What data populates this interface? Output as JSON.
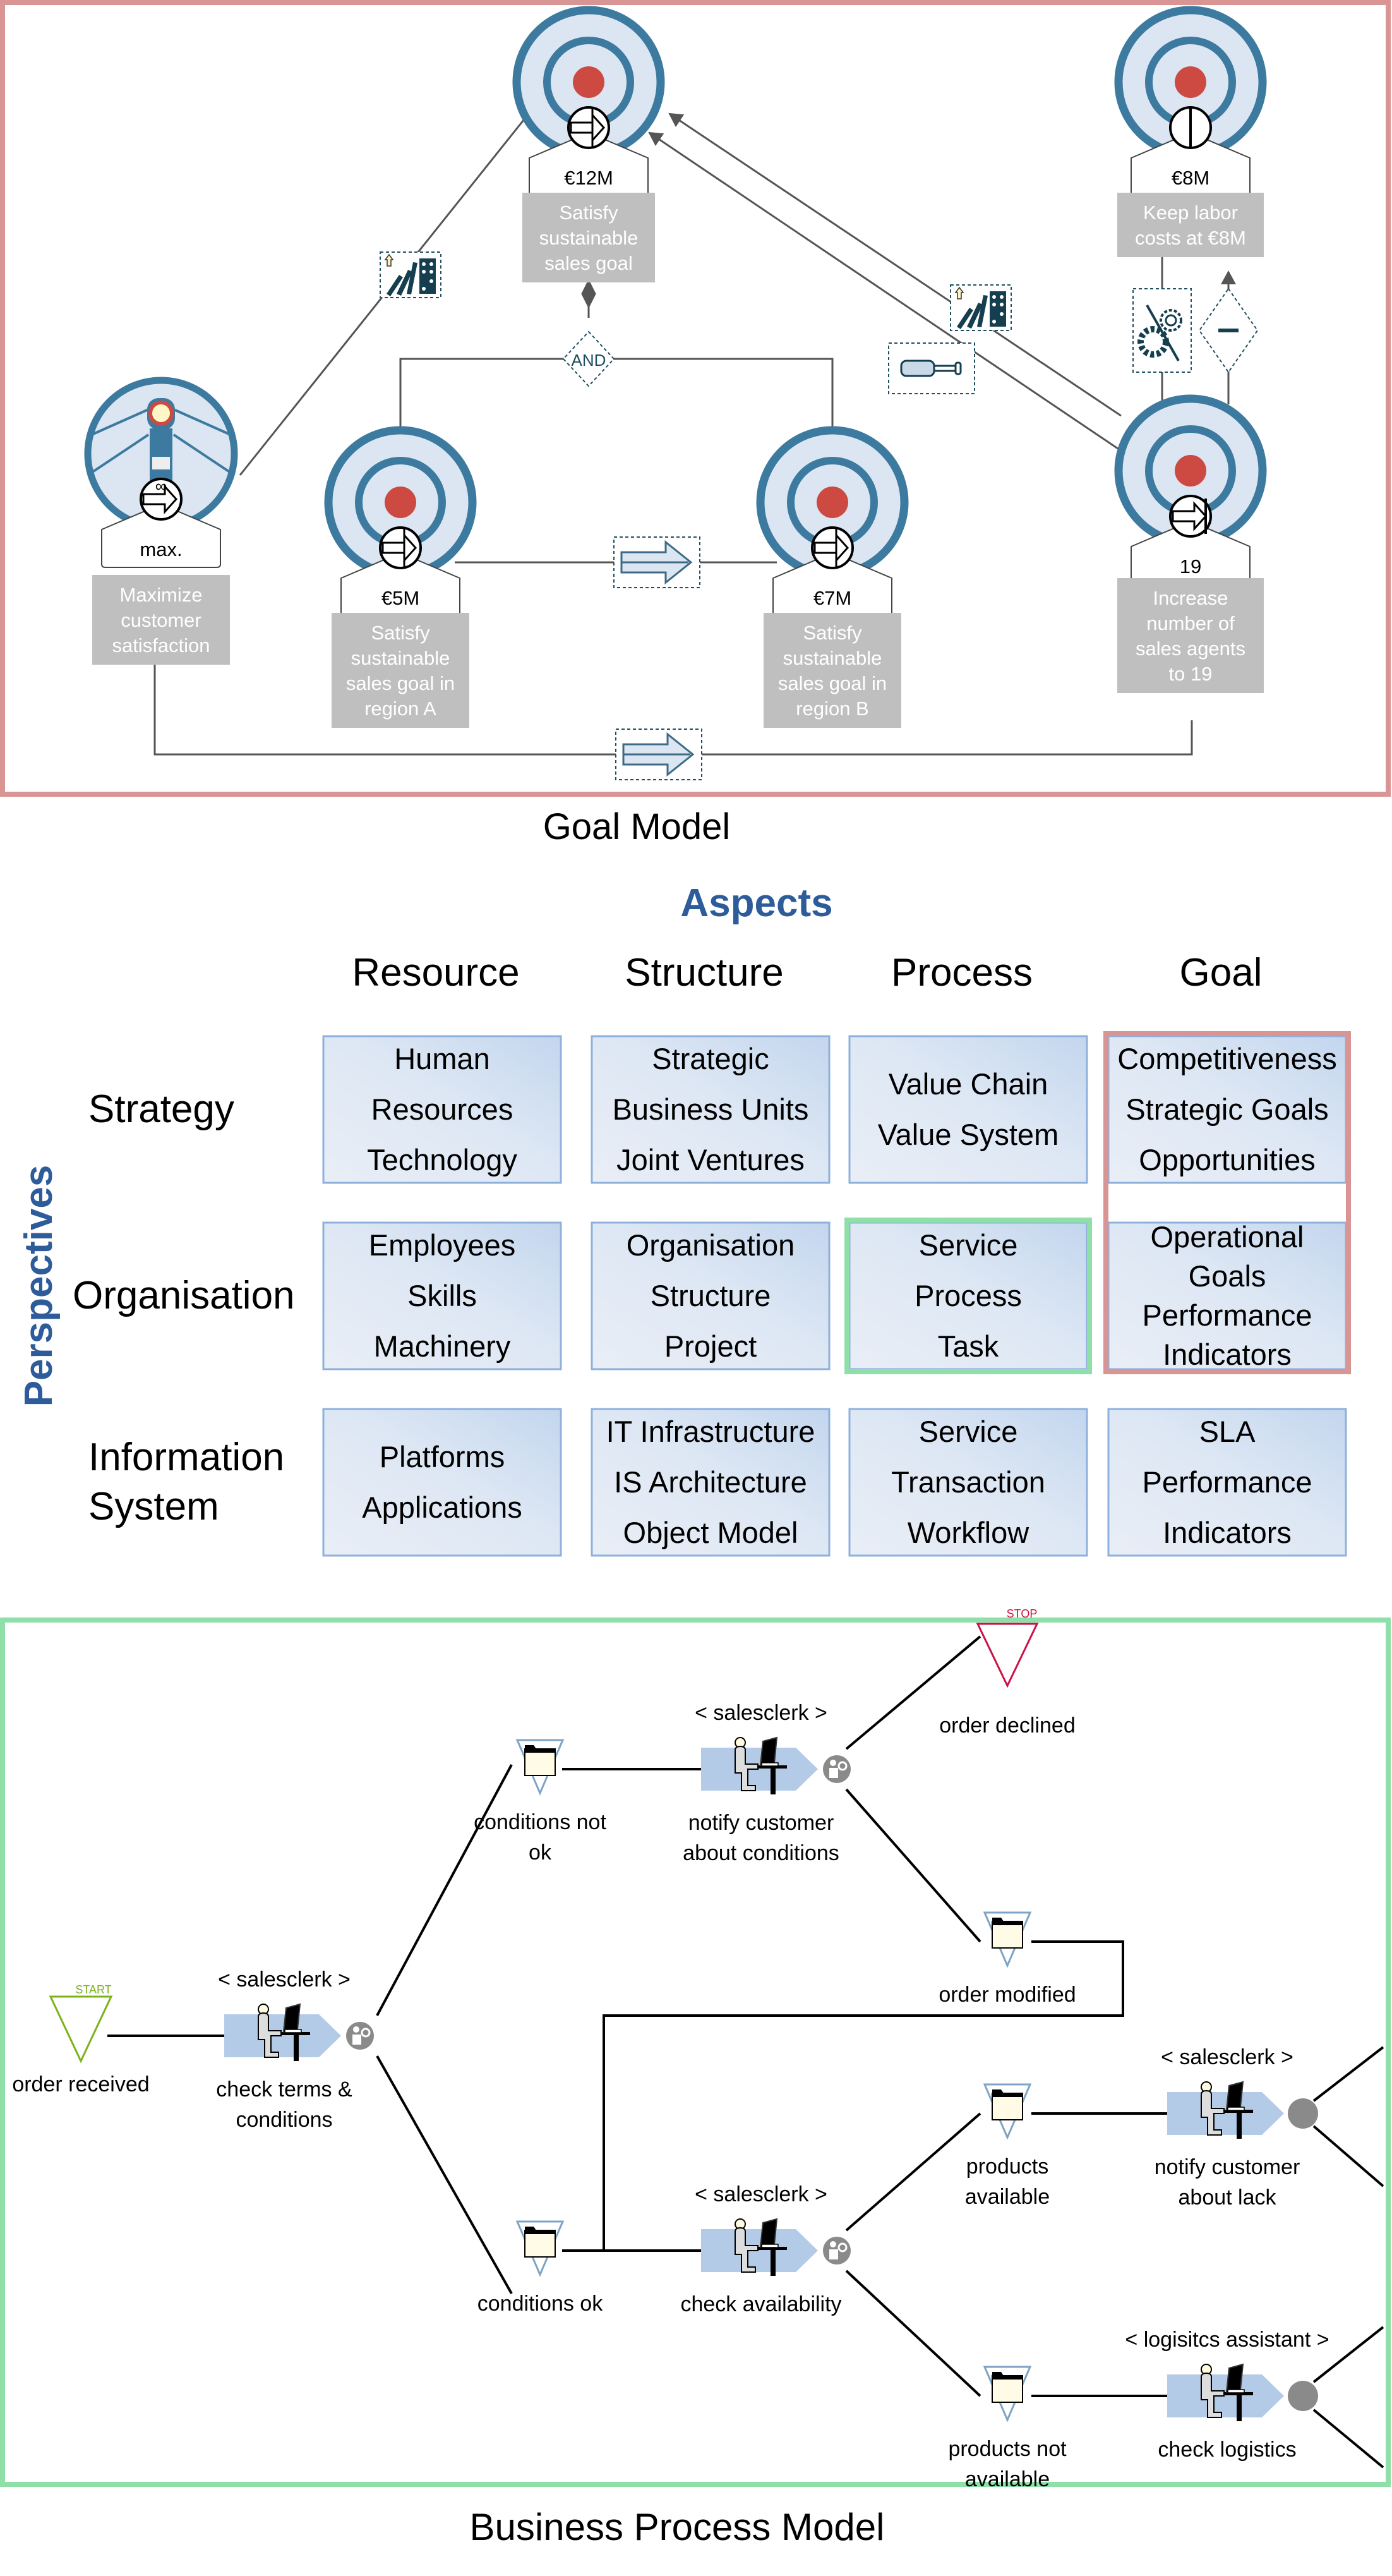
{
  "goal_model": {
    "caption": "Goal Model",
    "frame_color": "#d99594",
    "goals": [
      {
        "id": "g12",
        "kind": "target",
        "target_value": "€12M",
        "indicator": "achieve-arrow",
        "label_lines": [
          "Satisfy",
          "sustainable",
          "sales goal"
        ]
      },
      {
        "id": "g8",
        "kind": "target",
        "target_value": "€8M",
        "indicator": "keep-bar",
        "label_lines": [
          "Keep labor",
          "costs at €8M"
        ]
      },
      {
        "id": "gmax",
        "kind": "lighthouse",
        "target_value": "max.",
        "indicator": "maximize-infinity",
        "label_lines": [
          "Maximize",
          "customer",
          "satisfaction"
        ]
      },
      {
        "id": "g5",
        "kind": "target",
        "target_value": "€5M",
        "indicator": "achieve-arrow",
        "label_lines": [
          "Satisfy",
          "sustainable",
          "sales goal in",
          "region A"
        ]
      },
      {
        "id": "g7",
        "kind": "target",
        "target_value": "€7M",
        "indicator": "achieve-arrow",
        "label_lines": [
          "Satisfy",
          "sustainable",
          "sales goal in",
          "region B"
        ]
      },
      {
        "id": "g19",
        "kind": "target",
        "target_value": "19",
        "indicator": "increase-arrow",
        "label_lines": [
          "Increase",
          "number of",
          "sales agents",
          "to 19"
        ]
      }
    ],
    "and_label": "AND",
    "minus_label": "–"
  },
  "matrix": {
    "aspects_title": "Aspects",
    "perspectives_title": "Perspectives",
    "title_color": "#2e5c9a",
    "columns": [
      "Resource",
      "Structure",
      "Process",
      "Goal"
    ],
    "rows": [
      {
        "label_lines": [
          "Strategy"
        ],
        "cells": [
          [
            "Human",
            "Resources",
            "Technology"
          ],
          [
            "Strategic",
            "Business Units",
            "Joint Ventures"
          ],
          [
            "Value Chain",
            "Value System"
          ],
          [
            "Competitiveness",
            "Strategic Goals",
            "Opportunities"
          ]
        ]
      },
      {
        "label_lines": [
          "Organisation"
        ],
        "cells": [
          [
            "Employees",
            "Skills",
            "Machinery"
          ],
          [
            "Organisation",
            "Structure",
            "Project"
          ],
          [
            "Service",
            "Process",
            "Task"
          ],
          [
            "Operational",
            "Goals",
            "Performance",
            "Indicators"
          ]
        ]
      },
      {
        "label_lines": [
          "Information",
          "System"
        ],
        "cells": [
          [
            "Platforms",
            "Applications"
          ],
          [
            "IT Infrastructure",
            "IS Architecture",
            "Object Model"
          ],
          [
            "Service",
            "Transaction",
            "Workflow"
          ],
          [
            "SLA",
            "Performance",
            "Indicators"
          ]
        ]
      }
    ],
    "highlight_goal_color": "#d99594",
    "highlight_process_color": "#8fe0a8"
  },
  "process_model": {
    "caption": "Business Process Model",
    "frame_color": "#8fe0a8",
    "start_label": "START",
    "stop_label": "STOP",
    "events": {
      "order_received": "order received",
      "conditions_not_ok": [
        "conditions not",
        "ok"
      ],
      "conditions_ok": "conditions ok",
      "order_declined": "order declined",
      "order_modified": "order modified",
      "products_available": [
        "products",
        "available"
      ],
      "products_not_available": [
        "products not",
        "available"
      ]
    },
    "functions": [
      {
        "id": "f1",
        "role": "< salesclerk >",
        "label_lines": [
          "check terms &",
          "conditions"
        ]
      },
      {
        "id": "f2",
        "role": "< salesclerk >",
        "label_lines": [
          "notify customer",
          "about conditions"
        ]
      },
      {
        "id": "f3",
        "role": "< salesclerk >",
        "label_lines": [
          "check availability"
        ]
      },
      {
        "id": "f4",
        "role": "< salesclerk >",
        "label_lines": [
          "notify customer",
          "about lack"
        ]
      },
      {
        "id": "f5",
        "role": "< logisitcs assistant >",
        "label_lines": [
          "check logistics"
        ]
      }
    ]
  }
}
